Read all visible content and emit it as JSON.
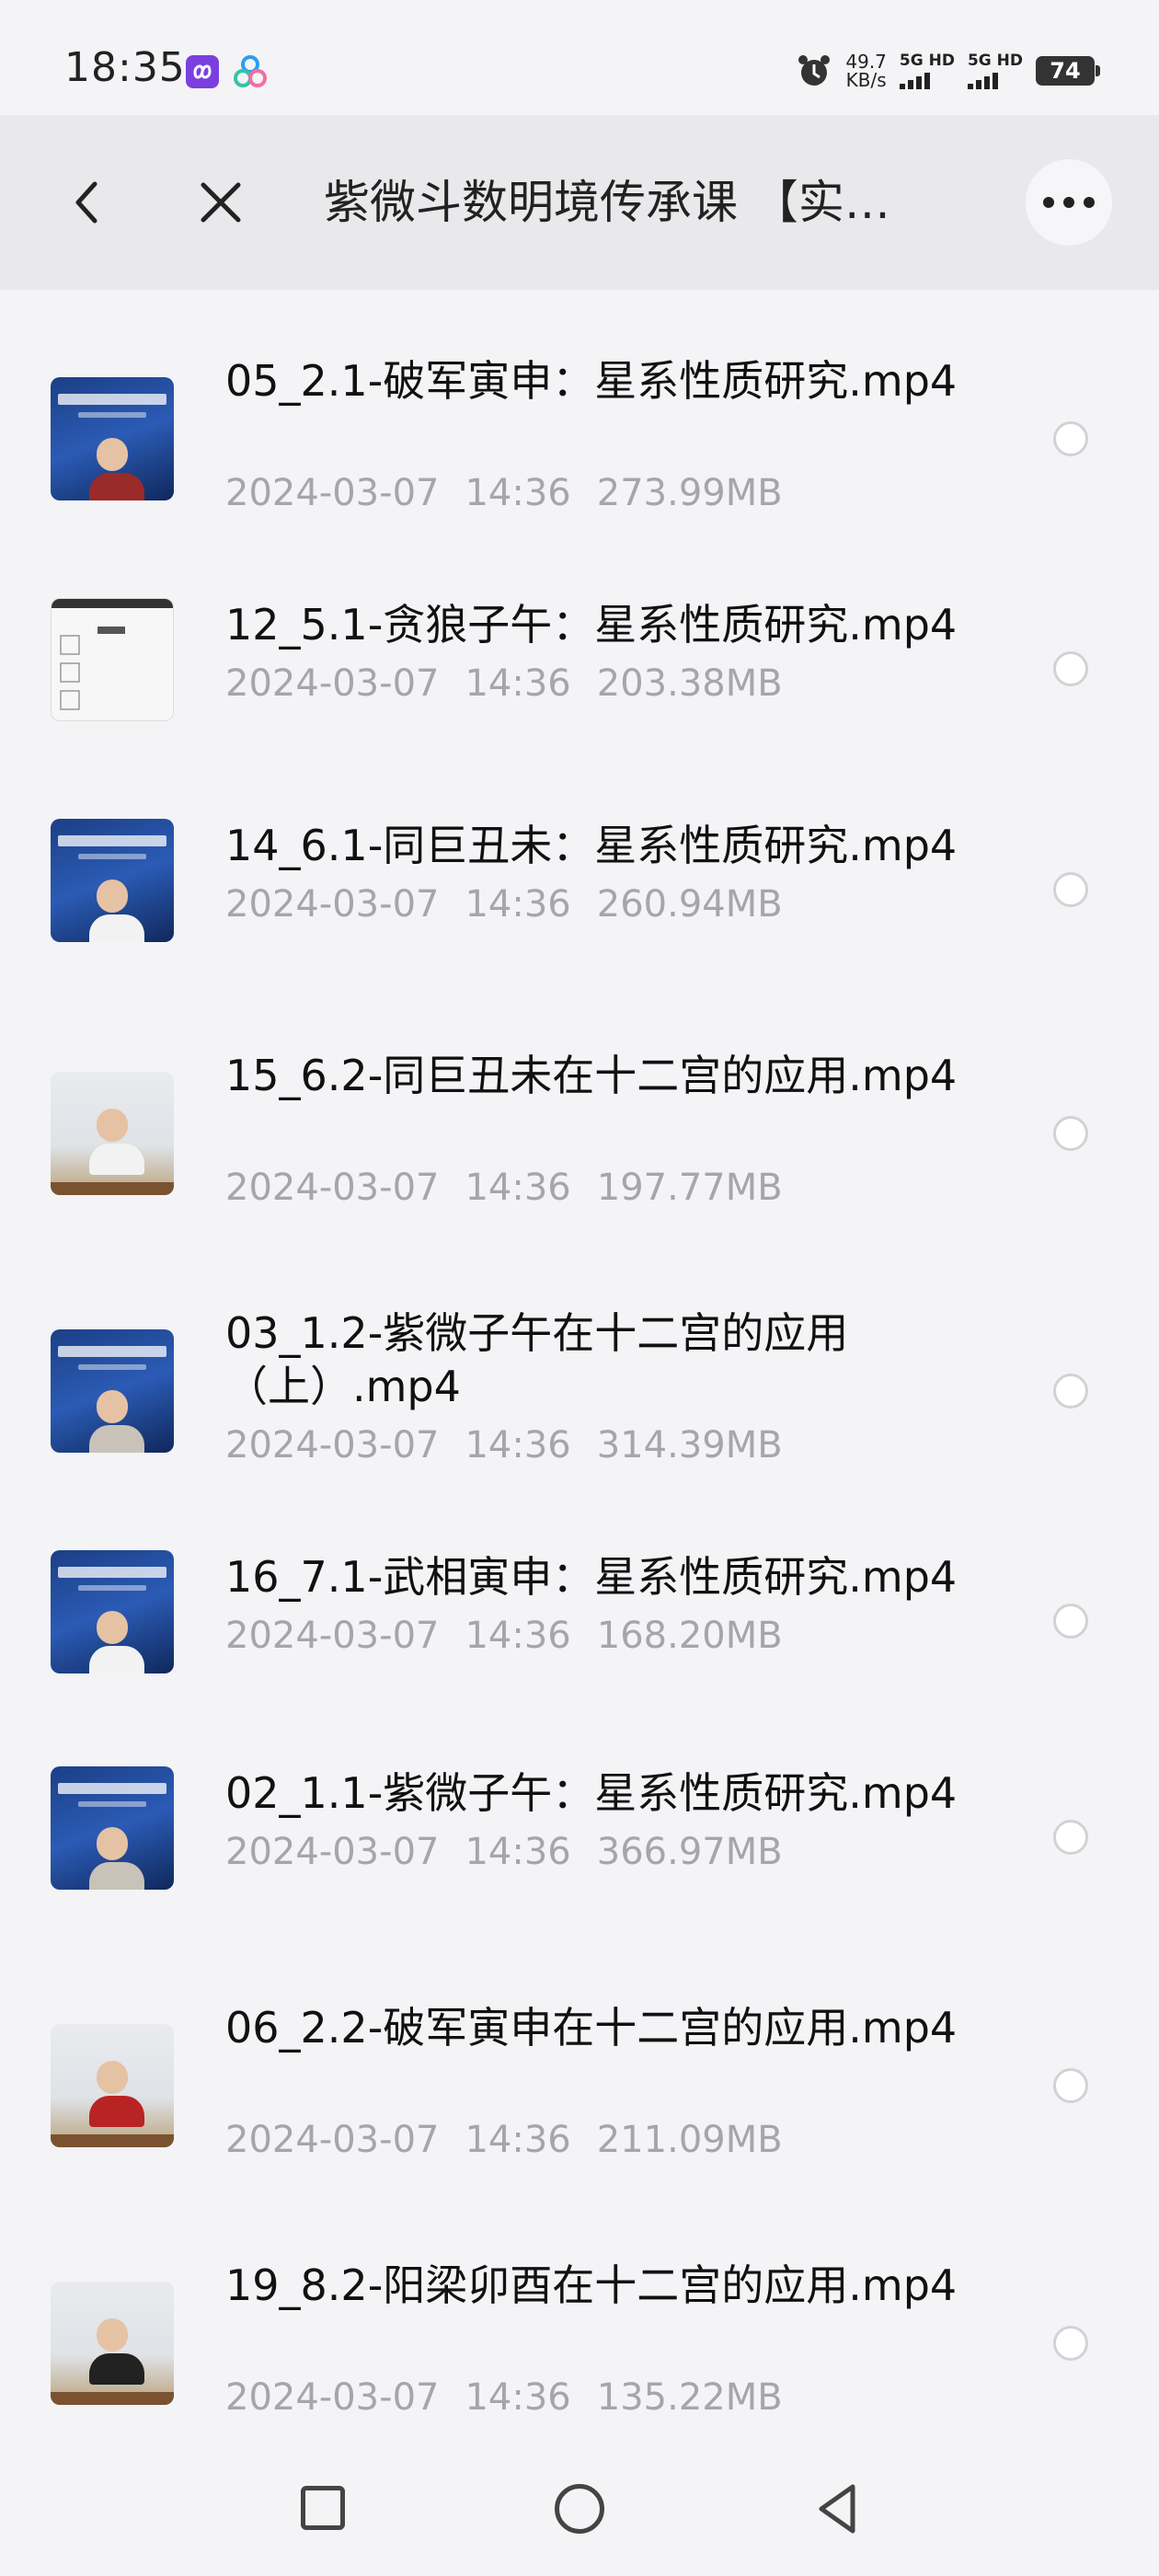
{
  "status_bar": {
    "time": "18:35",
    "net_speed_value": "49.7",
    "net_speed_unit": "KB/s",
    "sim1_label": "5G HD",
    "sim2_label": "5G HD",
    "battery": "74",
    "icons": [
      "soul-app-icon",
      "cloud-app-icon",
      "alarm-icon",
      "signal-icon",
      "battery-icon"
    ]
  },
  "header": {
    "title": "紫微斗数明境传承课 【实…",
    "back_icon": "chevron-left-icon",
    "close_icon": "close-icon",
    "more_icon": "more-dots-icon"
  },
  "files": [
    {
      "name": "05_2.1-破军寅申：星系性质研究.mp4",
      "date": "2024-03-07",
      "time": "14:36",
      "size": "273.99MB",
      "thumb": "blue",
      "shirt": "#9b2a2a"
    },
    {
      "name": "12_5.1-贪狼子午：星系性质研究.mp4",
      "date": "2024-03-07",
      "time": "14:36",
      "size": "203.38MB",
      "thumb": "doc",
      "shirt": "#999999"
    },
    {
      "name": "14_6.1-同巨丑未：星系性质研究.mp4",
      "date": "2024-03-07",
      "time": "14:36",
      "size": "260.94MB",
      "thumb": "blue",
      "shirt": "#f2f2f2"
    },
    {
      "name": "15_6.2-同巨丑未在十二宫的应用.mp4",
      "date": "2024-03-07",
      "time": "14:36",
      "size": "197.77MB",
      "thumb": "room",
      "shirt": "#f2f2f2"
    },
    {
      "name": "03_1.2-紫微子午在十二宫的应用（上）.mp4",
      "date": "2024-03-07",
      "time": "14:36",
      "size": "314.39MB",
      "thumb": "blue",
      "shirt": "#c9c2b8"
    },
    {
      "name": "16_7.1-武相寅申：星系性质研究.mp4",
      "date": "2024-03-07",
      "time": "14:36",
      "size": "168.20MB",
      "thumb": "blue",
      "shirt": "#f2f2f2"
    },
    {
      "name": "02_1.1-紫微子午：星系性质研究.mp4",
      "date": "2024-03-07",
      "time": "14:36",
      "size": "366.97MB",
      "thumb": "blue",
      "shirt": "#c9c2b8"
    },
    {
      "name": "06_2.2-破军寅申在十二宫的应用.mp4",
      "date": "2024-03-07",
      "time": "14:36",
      "size": "211.09MB",
      "thumb": "room",
      "shirt": "#b82424"
    },
    {
      "name": "19_8.2-阳梁卯酉在十二宫的应用.mp4",
      "date": "2024-03-07",
      "time": "14:36",
      "size": "135.22MB",
      "thumb": "room",
      "shirt": "#222222"
    }
  ],
  "nav_bar": {
    "icons": [
      "recent-apps-icon",
      "home-icon",
      "back-triangle-icon"
    ]
  }
}
